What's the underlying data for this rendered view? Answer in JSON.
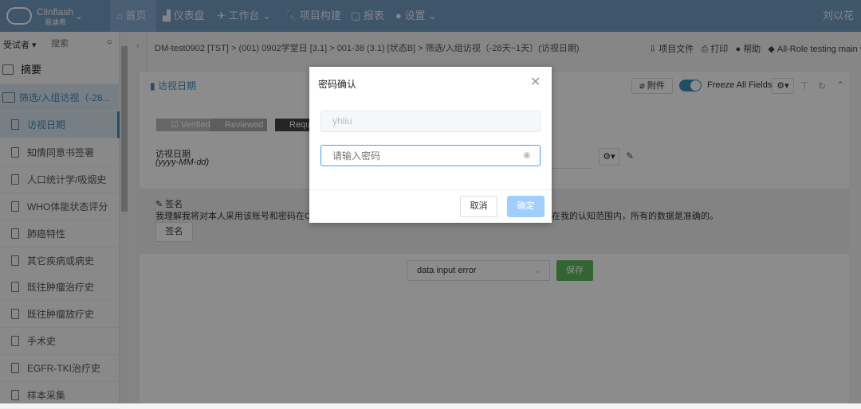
{
  "header": {
    "brand": "Clinflash",
    "brand_sub": "易迪希",
    "nav": [
      "首页",
      "仪表盘",
      "工作台",
      "项目构建",
      "报表",
      "设置"
    ],
    "user": "刘以花"
  },
  "sidebar": {
    "filter": "受试者",
    "search_placeholder": "搜索",
    "items": [
      "摘要",
      "筛选/入组访视（-28...",
      "访视日期",
      "知情同意书签署",
      "人口统计学/吸烟史",
      "WHO体能状态评分",
      "肺癌特性",
      "其它疾病或病史",
      "既往肿瘤治疗史",
      "既往肿瘤放疗史",
      "手术史",
      "EGFR-TKI治疗史",
      "样本采集"
    ]
  },
  "breadcrumb": [
    "DM-test0902 [TST]",
    "(001) 0902学堂日 [3.1]",
    "001-38 (3.1) [状态B]",
    "筛选/入组访视（-28天~1天）(访视日期)"
  ],
  "toplinks": [
    "项目文件",
    "打印",
    "帮助",
    "All-Role testing main"
  ],
  "form": {
    "title": "访视日期",
    "attach": "附件",
    "freeze": "Freeze All Fields",
    "badges": [
      "Verified",
      "Reviewed",
      "Requ"
    ],
    "field_label": "访视日期",
    "field_format": "(yyyy-MM-dd)",
    "sig_title": "签名",
    "sig_text_left": "我理解我将对本人采用该账号和密码在Clin",
    "sig_text_right": "在我的认知范围内，所有的数据是准确的。",
    "sig_button": "签名",
    "reason": "data input error",
    "save": "保存"
  },
  "modal": {
    "title": "密码确认",
    "username": "yhliu",
    "password_placeholder": "请输入密码",
    "cancel": "取消",
    "confirm": "确定"
  },
  "colors": {
    "header": "#739cc1",
    "primary": "#409eff",
    "save": "#5cb85c"
  }
}
